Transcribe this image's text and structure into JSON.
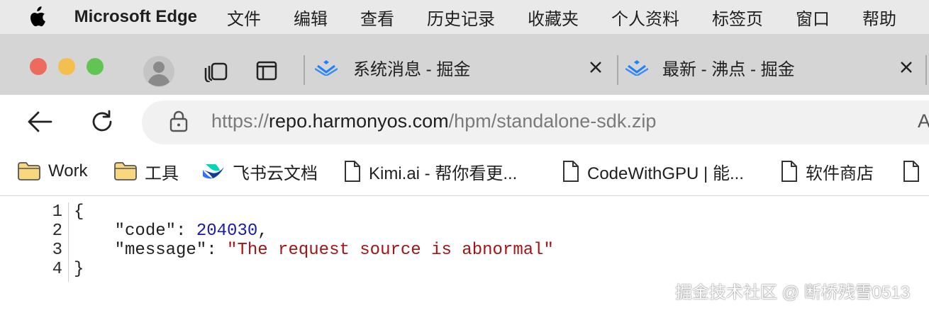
{
  "menubar": {
    "app_name": "Microsoft Edge",
    "items": [
      "文件",
      "编辑",
      "查看",
      "历史记录",
      "收藏夹",
      "个人资料",
      "标签页",
      "窗口",
      "帮助"
    ]
  },
  "tabs": [
    {
      "title": "系统消息 - 掘金"
    },
    {
      "title": "最新 - 沸点 - 掘金"
    }
  ],
  "address_bar": {
    "scheme": "https://",
    "host": "repo.harmonyos.com",
    "path": "/hpm/standalone-sdk.zip",
    "trailing_glyph": "A"
  },
  "bookmarks": [
    {
      "label": "Work",
      "icon": "folder-icon"
    },
    {
      "label": "工具",
      "icon": "folder-icon"
    },
    {
      "label": "飞书云文档",
      "icon": "feishu-logo-icon"
    },
    {
      "label": "Kimi.ai - 帮你看更...",
      "icon": "document-icon"
    },
    {
      "label": "CodeWithGPU | 能...",
      "icon": "document-icon"
    },
    {
      "label": "软件商店",
      "icon": "document-icon"
    }
  ],
  "json_view": {
    "line_numbers": [
      "1",
      "2",
      "3",
      "4"
    ],
    "open_brace": "{",
    "close_brace": "}",
    "key_code": "\"code\"",
    "value_code": "204030",
    "key_message": "\"message\"",
    "value_message": "\"The request source is abnormal\""
  },
  "watermark": "掘金技术社区 @ 断桥残雪0513",
  "colors": {
    "close": "#ed6a5e",
    "minimize": "#f5bf4f",
    "zoom": "#61c554",
    "number": "#1a1aa6",
    "string": "#a31515",
    "juejin_blue": "#1e80ff"
  }
}
